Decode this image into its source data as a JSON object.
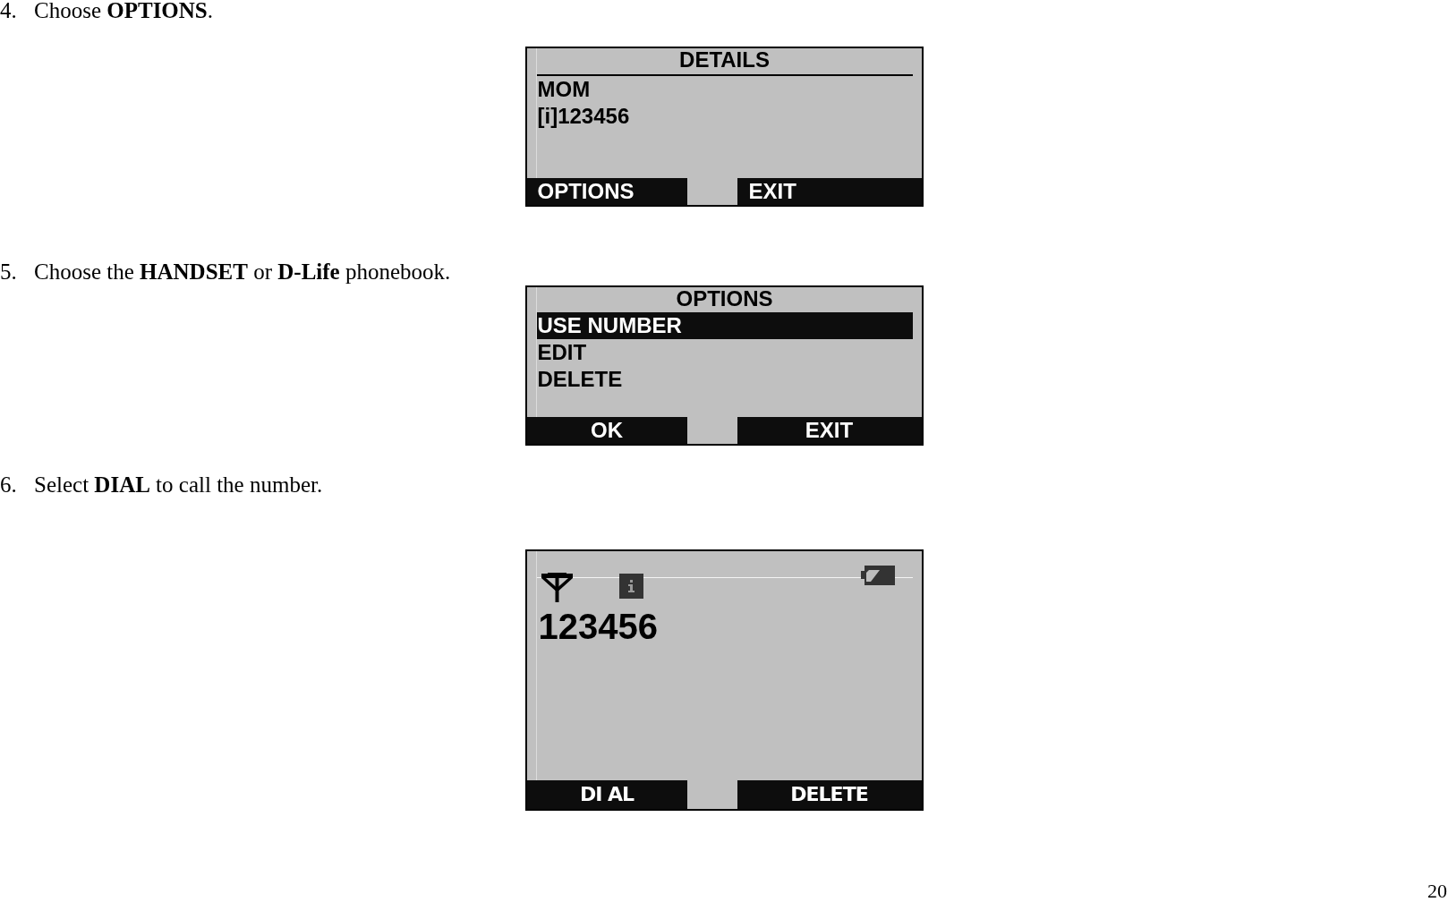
{
  "steps": [
    {
      "number": "4.",
      "instruction": "Choose **OPTIONS**.",
      "screen": {
        "kind": "details",
        "title": "DETAILS",
        "name": "MOM",
        "number": "[i]123456",
        "softkeys": {
          "left": "OPTIONS",
          "right": "EXIT"
        }
      }
    },
    {
      "number": "5.",
      "instruction": "Choose the **HANDSET** or **D-Life** phonebook.",
      "screen": {
        "kind": "menu",
        "title": "OPTIONS",
        "items": [
          {
            "label": "USE NUMBER",
            "selected": true
          },
          {
            "label": "EDIT",
            "selected": false
          },
          {
            "label": "DELETE",
            "selected": false
          }
        ],
        "softkeys": {
          "left": "OK",
          "right": "EXIT"
        }
      }
    },
    {
      "number": "6.",
      "instruction": "Select **DIAL** to call the number.",
      "screen": {
        "kind": "dial",
        "number": "123456",
        "softkeys": {
          "left": "DI AL",
          "right": "DELETE"
        }
      }
    }
  ],
  "page_number": "20"
}
